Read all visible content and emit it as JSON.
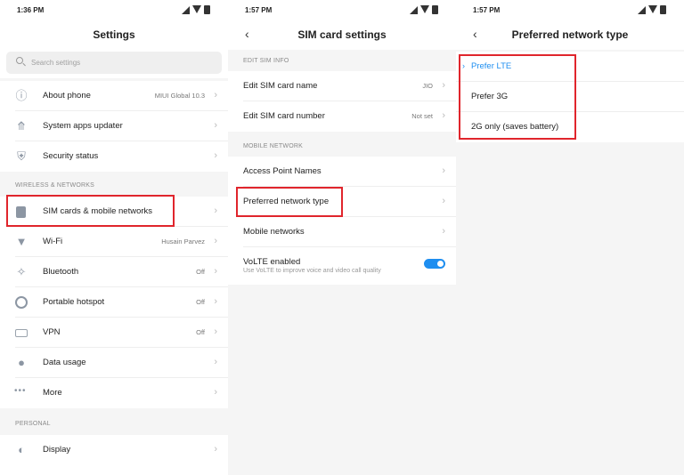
{
  "panel1": {
    "status_time": "1:36 PM",
    "title": "Settings",
    "search_placeholder": "Search settings",
    "items": [
      {
        "label": "About phone",
        "value": "MIUI Global 10.3"
      },
      {
        "label": "System apps updater",
        "value": ""
      },
      {
        "label": "Security status",
        "value": ""
      }
    ],
    "section_wireless": "WIRELESS & NETWORKS",
    "wireless": [
      {
        "label": "SIM cards & mobile networks",
        "value": ""
      },
      {
        "label": "Wi-Fi",
        "value": "Husain Parvez"
      },
      {
        "label": "Bluetooth",
        "value": "Off"
      },
      {
        "label": "Portable hotspot",
        "value": "Off"
      },
      {
        "label": "VPN",
        "value": "Off"
      },
      {
        "label": "Data usage",
        "value": ""
      },
      {
        "label": "More",
        "value": ""
      }
    ],
    "section_personal": "PERSONAL",
    "personal": [
      {
        "label": "Display",
        "value": ""
      }
    ]
  },
  "panel2": {
    "status_time": "1:57 PM",
    "title": "SIM card settings",
    "section_sim": "EDIT SIM INFO",
    "sim": [
      {
        "label": "Edit SIM card name",
        "value": "JIO"
      },
      {
        "label": "Edit SIM card number",
        "value": "Not set"
      }
    ],
    "section_mobile": "MOBILE NETWORK",
    "mobile": [
      {
        "label": "Access Point Names"
      },
      {
        "label": "Preferred network type"
      },
      {
        "label": "Mobile networks"
      }
    ],
    "volte": {
      "label": "VoLTE enabled",
      "sub": "Use VoLTE to improve voice and video call quality",
      "on": true
    }
  },
  "panel3": {
    "status_time": "1:57 PM",
    "title": "Preferred network type",
    "options": [
      {
        "label": "Prefer LTE",
        "selected": true
      },
      {
        "label": "Prefer 3G",
        "selected": false
      },
      {
        "label": "2G only (saves battery)",
        "selected": false
      }
    ]
  },
  "colors": {
    "accent": "#1e8ef0",
    "highlight": "#e0252c"
  },
  "icons": {
    "back": "back-arrow-icon",
    "chevron": "chevron-right-icon",
    "search": "search-icon"
  }
}
